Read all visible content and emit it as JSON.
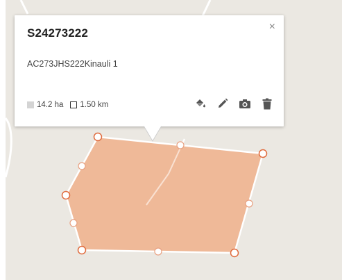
{
  "map": {
    "colors": {
      "background": "#ebe8e2",
      "road": "#ffffff",
      "polygon_fill": "#f0b08b",
      "polygon_stroke": "#ffffff",
      "vertex_stroke": "#e06a3c"
    }
  },
  "popup": {
    "title": "S24273222",
    "description": "AC273JHS222Kinauli 1",
    "close_label": "×",
    "area": "14.2 ha",
    "perimeter": "1.50 km",
    "actions": [
      {
        "name": "fill-color",
        "icon": "paint-bucket-icon"
      },
      {
        "name": "edit",
        "icon": "pencil-icon"
      },
      {
        "name": "photo",
        "icon": "camera-icon"
      },
      {
        "name": "delete",
        "icon": "trash-icon"
      }
    ]
  }
}
